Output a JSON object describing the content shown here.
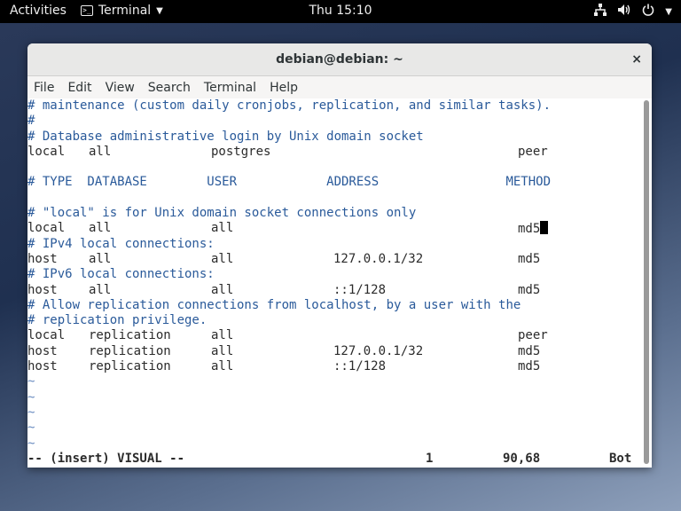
{
  "topbar": {
    "activities": "Activities",
    "app_name": "Terminal",
    "clock": "Thu 15:10",
    "icons": [
      "network-icon",
      "volume-icon",
      "power-icon"
    ]
  },
  "window": {
    "title": "debian@debian: ~",
    "close": "×",
    "menu": [
      "File",
      "Edit",
      "View",
      "Search",
      "Terminal",
      "Help"
    ]
  },
  "terminal": {
    "comments": [
      "# maintenance (custom daily cronjobs, replication, and similar tasks).",
      "#",
      "# Database administrative login by Unix domain socket",
      "# TYPE  DATABASE        USER            ADDRESS                 METHOD",
      "# \"local\" is for Unix domain socket connections only",
      "# IPv4 local connections:",
      "# IPv6 local connections:",
      "# Allow replication connections from localhost, by a user with the",
      "# replication privilege."
    ],
    "rows": [
      [
        "local",
        "all",
        "postgres",
        "",
        "peer"
      ],
      [
        "local",
        "all",
        "all",
        "",
        "md5"
      ],
      [
        "host",
        "all",
        "all",
        "127.0.0.1/32",
        "md5"
      ],
      [
        "host",
        "all",
        "all",
        "::1/128",
        "md5"
      ],
      [
        "local",
        "replication",
        "all",
        "",
        "peer"
      ],
      [
        "host",
        "replication",
        "all",
        "127.0.0.1/32",
        "md5"
      ],
      [
        "host",
        "replication",
        "all",
        "::1/128",
        "md5"
      ]
    ],
    "tilde": "~",
    "status": {
      "mode": "-- (insert) VISUAL --",
      "count": "1",
      "position": "90,68",
      "scroll": "Bot"
    }
  }
}
